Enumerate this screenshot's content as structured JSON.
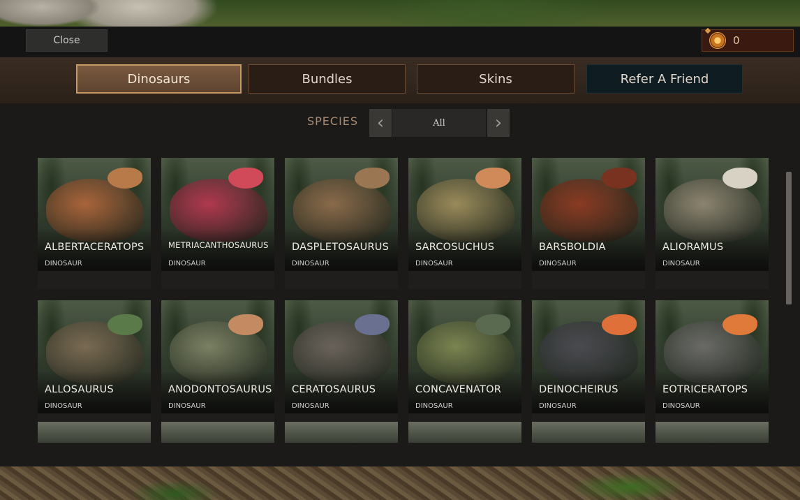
{
  "topbar": {
    "close_label": "Close",
    "currency_value": "0",
    "currency_icon": "crest-coin-icon"
  },
  "tabs": [
    {
      "label": "Dinosaurs",
      "active": true
    },
    {
      "label": "Bundles",
      "active": false
    },
    {
      "label": "Skins",
      "active": false
    },
    {
      "label": "Refer A Friend",
      "active": false
    }
  ],
  "species": {
    "label": "SPECIES",
    "value": "All",
    "prev_icon": "chevron-left-icon",
    "next_icon": "chevron-right-icon"
  },
  "cards": [
    {
      "name": "ALBERTACERATOPS",
      "type": "DINOSAUR",
      "body": "#a9643a",
      "head": "#b87a48"
    },
    {
      "name": "METRIACANTHOSAURUS",
      "type": "DINOSAUR",
      "body": "#b0384e",
      "head": "#d04a5a"
    },
    {
      "name": "DASPLETOSAURUS",
      "type": "DINOSAUR",
      "body": "#8a6a4a",
      "head": "#9a7652"
    },
    {
      "name": "SARCOSUCHUS",
      "type": "DINOSAUR",
      "body": "#9a8a5a",
      "head": "#d08a5a"
    },
    {
      "name": "BARSBOLDIA",
      "type": "DINOSAUR",
      "body": "#8a3a22",
      "head": "#7a3220"
    },
    {
      "name": "ALIORAMUS",
      "type": "DINOSAUR",
      "body": "#8c8470",
      "head": "#d8d2c4"
    },
    {
      "name": "ALLOSAURUS",
      "type": "DINOSAUR",
      "body": "#7a6a52",
      "head": "#5a7a4a"
    },
    {
      "name": "ANODONTOSAURUS",
      "type": "DINOSAUR",
      "body": "#7a8062",
      "head": "#c48a62"
    },
    {
      "name": "CERATOSAURUS",
      "type": "DINOSAUR",
      "body": "#6a625a",
      "head": "#6a7090"
    },
    {
      "name": "CONCAVENATOR",
      "type": "DINOSAUR",
      "body": "#7a8450",
      "head": "#5a6a50"
    },
    {
      "name": "DEINOCHEIRUS",
      "type": "DINOSAUR",
      "body": "#4a4a50",
      "head": "#e0703a"
    },
    {
      "name": "EOTRICERATOPS",
      "type": "DINOSAUR",
      "body": "#6a6a66",
      "head": "#e07a3a"
    }
  ]
}
